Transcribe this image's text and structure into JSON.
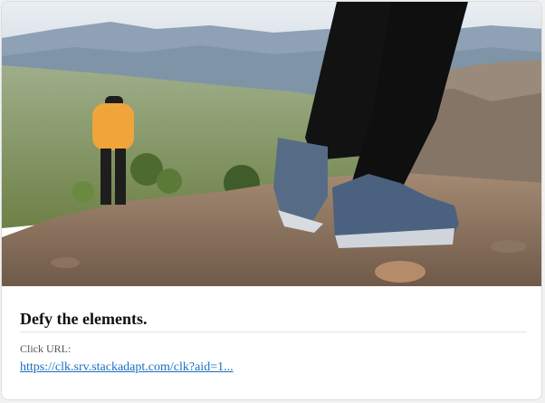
{
  "ad": {
    "image_description": "hiking-scene-photo",
    "headline": "Defy the elements.",
    "click_label": "Click URL:",
    "click_url_text": "https://clk.srv.stackadapt.com/clk?aid=1..."
  },
  "colors": {
    "link": "#1a6fbf",
    "headline": "#111111",
    "label": "#555555"
  }
}
